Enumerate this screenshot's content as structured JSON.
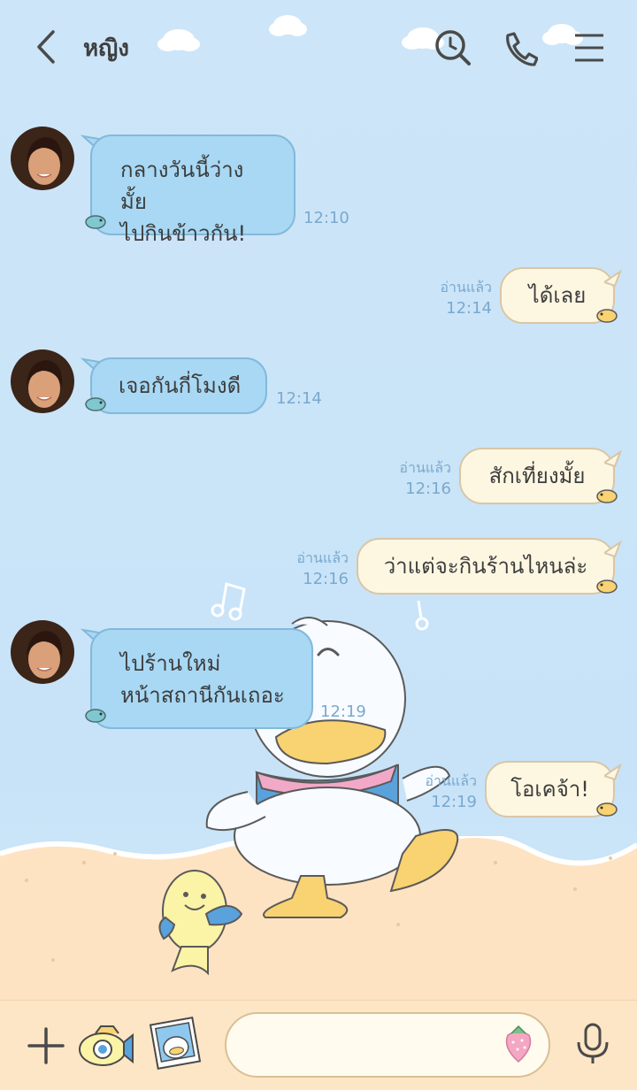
{
  "header": {
    "title": "หญิง",
    "icons": [
      "back-chevron-icon",
      "search-history-icon",
      "phone-icon",
      "menu-icon"
    ]
  },
  "messages": [
    {
      "side": "in",
      "lines": [
        "กลางวันนี้ว่างมั้ย",
        "ไปกินข้าวกัน!"
      ],
      "time": "12:10"
    },
    {
      "side": "out",
      "text": "ได้เลย",
      "read": "อ่านแล้ว",
      "time": "12:14"
    },
    {
      "side": "in",
      "lines": [
        "เจอกันกี่โมงดี"
      ],
      "time": "12:14"
    },
    {
      "side": "out",
      "text": "สักเที่ยงมั้ย",
      "read": "อ่านแล้ว",
      "time": "12:16"
    },
    {
      "side": "out",
      "text": "ว่าแต่จะกินร้านไหนล่ะ",
      "read": "อ่านแล้ว",
      "time": "12:16"
    },
    {
      "side": "in",
      "lines": [
        "ไปร้านใหม่",
        "หน้าสถานีกันเถอะ"
      ],
      "time": "12:19"
    },
    {
      "side": "out",
      "text": "โอเคจ้า!",
      "read": "อ่านแล้ว",
      "time": "12:19"
    }
  ],
  "bottom_bar": {
    "icons": [
      "plus-icon",
      "camera-icon",
      "photo-album-icon",
      "strawberry-sticker-icon",
      "microphone-icon"
    ],
    "message_input_value": ""
  },
  "theme": {
    "background": "#cde5f8",
    "incoming_bubble": "#a8d8f4",
    "outgoing_bubble": "#fdf7e2",
    "sand": "#fde3c2",
    "time_text": "#7aa9cf"
  }
}
